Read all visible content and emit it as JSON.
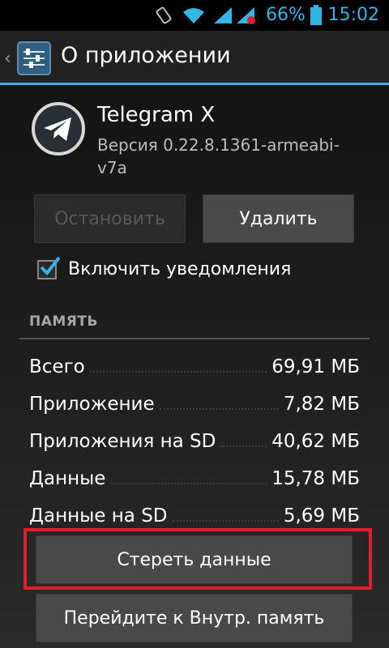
{
  "status_bar": {
    "battery_percent": "66%",
    "time": "15:02",
    "icons": [
      "rotate-icon",
      "wifi-icon",
      "signal-icon",
      "battery-icon"
    ]
  },
  "action_bar": {
    "title": "О приложении",
    "icon": "settings-sliders-icon"
  },
  "app": {
    "name": "Telegram X",
    "version": "Версия 0.22.8.1361-armeabi-v7a",
    "icon": "telegram-icon"
  },
  "buttons": {
    "stop": "Остановить",
    "delete": "Удалить",
    "clear_data": "Стереть данные",
    "move_storage": "Перейдите к Внутр. память"
  },
  "notifications": {
    "label": "Включить уведомления",
    "checked": true
  },
  "memory": {
    "header": "ПАМЯТЬ",
    "rows": [
      {
        "label": "Всего",
        "value": "69,91 МБ"
      },
      {
        "label": "Приложение",
        "value": "7,82 МБ"
      },
      {
        "label": "Приложения на SD",
        "value": "40,62 МБ"
      },
      {
        "label": "Данные",
        "value": "15,78 МБ"
      },
      {
        "label": "Данные на SD",
        "value": "5,69 МБ"
      }
    ]
  },
  "colors": {
    "accent": "#33b5e5",
    "highlight": "#e21e2a"
  }
}
